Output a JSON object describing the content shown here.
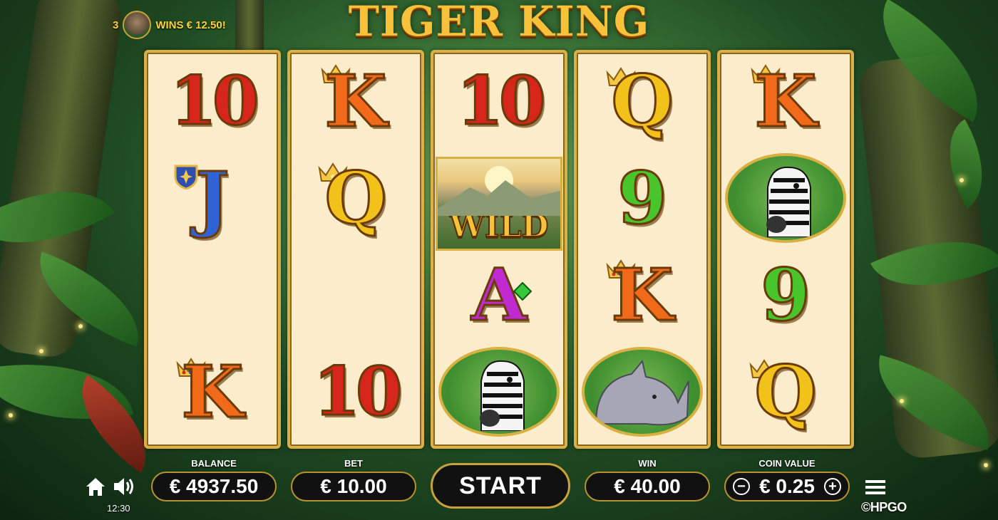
{
  "game": {
    "title": "TIGER KING",
    "ticker": {
      "count": "3",
      "message": "WINS € 12.50!"
    }
  },
  "reels": [
    {
      "symbols": [
        {
          "id": "ten",
          "label": "10",
          "color": "#d6261b"
        },
        {
          "id": "jack",
          "label": "J",
          "color": "#2f63d8",
          "badge": "fleur-shield-icon"
        },
        {
          "id": "blank",
          "label": ""
        },
        {
          "id": "king",
          "label": "K",
          "color": "#f06a1a",
          "badge": "crown-icon"
        }
      ]
    },
    {
      "symbols": [
        {
          "id": "king",
          "label": "K",
          "color": "#f06a1a",
          "badge": "crown-icon"
        },
        {
          "id": "queen",
          "label": "Q",
          "color": "#f2c21a",
          "badge": "crown-icon"
        },
        {
          "id": "blank",
          "label": ""
        },
        {
          "id": "ten",
          "label": "10",
          "color": "#d6261b"
        }
      ]
    },
    {
      "symbols": [
        {
          "id": "ten",
          "label": "10",
          "color": "#d6261b"
        },
        {
          "id": "wild",
          "label": "WILD"
        },
        {
          "id": "ace",
          "label": "A",
          "color": "#c02ad0",
          "badge": "green-gem-icon"
        },
        {
          "id": "zebra",
          "label": ""
        }
      ]
    },
    {
      "symbols": [
        {
          "id": "queen",
          "label": "Q",
          "color": "#f2c21a",
          "badge": "crown-icon"
        },
        {
          "id": "nine",
          "label": "9",
          "color": "#47c52a"
        },
        {
          "id": "king",
          "label": "K",
          "color": "#f06a1a",
          "badge": "crown-icon"
        },
        {
          "id": "rhino",
          "label": ""
        }
      ]
    },
    {
      "symbols": [
        {
          "id": "king",
          "label": "K",
          "color": "#f06a1a",
          "badge": "crown-icon"
        },
        {
          "id": "zebra",
          "label": ""
        },
        {
          "id": "nine",
          "label": "9",
          "color": "#47c52a"
        },
        {
          "id": "queen",
          "label": "Q",
          "color": "#f2c21a",
          "badge": "crown-icon"
        }
      ]
    }
  ],
  "controls": {
    "balance_label": "BALANCE",
    "balance_value": "€ 4937.50",
    "bet_label": "BET",
    "bet_value": "€ 10.00",
    "start_label": "START",
    "win_label": "WIN",
    "win_value": "€ 40.00",
    "coin_label": "COIN VALUE",
    "coin_value": "€ 0.25",
    "coin_decrease": "−",
    "coin_increase": "+",
    "clock": "12:30",
    "brand": "©HPGO"
  },
  "colors": {
    "gold": "#d9b04a",
    "reel_bg": "#fbeccb",
    "pill_bg": "#111111"
  }
}
